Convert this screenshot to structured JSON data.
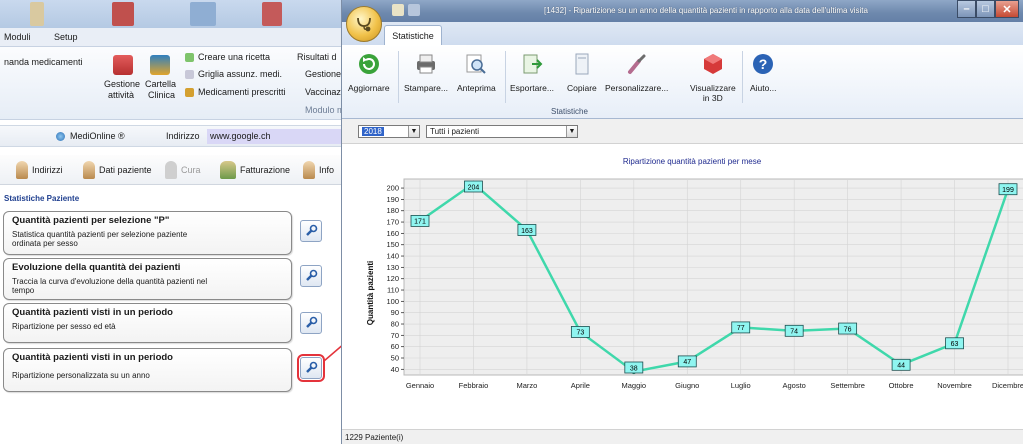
{
  "bg_app": {
    "menu": [
      "Moduli",
      "Setup"
    ],
    "ribbon": {
      "left_cut_label": "nanda medicamenti",
      "gestione_attivita": [
        "Gestione",
        "attività"
      ],
      "cartella_clinica": [
        "Cartella",
        "Clinica"
      ],
      "links": [
        "Creare una ricetta",
        "Griglia assunz. medi.",
        "Medicamenti prescritti"
      ],
      "cut_links": [
        "Risultati d",
        "Gestione",
        "Vaccinazi"
      ],
      "group_label": "Modulo m"
    },
    "address_bar": {
      "app_name": "MediOnline ®",
      "address_label": "Indirizzo",
      "url": "www.google.ch"
    },
    "tabs": [
      "Indirizzi",
      "Dati paziente",
      "Cura",
      "Fatturazione",
      "Info"
    ],
    "section_title": "Statistiche Paziente",
    "cards": [
      {
        "title": "Quantità pazienti per selezione \"P\"",
        "desc": "Statistica quantità pazienti per selezione paziente ordinata per sesso"
      },
      {
        "title": "Evoluzione della quantità dei pazienti",
        "desc": "Traccia la curva d'evoluzione della quantità pazienti nel tempo"
      },
      {
        "title": "Quantità pazienti visti in un periodo",
        "desc": "Ripartizione per sesso ed età"
      },
      {
        "title": "Quantità pazienti visti in un periodo",
        "desc": "Ripartizione personalizzata su un anno"
      }
    ]
  },
  "window": {
    "title": "[1432] - Ripartizione su un anno della quantità pazienti in rapporto alla data dell'ultima visita",
    "ribbon_tab": "Statistiche",
    "buttons": {
      "aggiornare": "Aggiornare",
      "stampare": "Stampare...",
      "anteprima": "Anteprima",
      "esportare": "Esportare...",
      "copiare": "Copiare",
      "personalizzare": "Personalizzare...",
      "visualizzare": [
        "Visualizzare",
        "in 3D"
      ],
      "aiuto": "Aiuto..."
    },
    "group_label": "Statistiche",
    "filters": {
      "year": "2018",
      "patients": "Tutti i pazienti"
    },
    "status": "1229 Paziente(i)"
  },
  "colors": {
    "line": "#3fd8ab",
    "label_fill": "#8ff5f0",
    "plot_bg": "#eeeeee",
    "callout": "#e4333b"
  },
  "chart_data": {
    "type": "line",
    "title": "Ripartizione quantità pazienti per mese",
    "ylabel": "Quantità pazienti",
    "xlabel": "",
    "categories": [
      "Gennaio",
      "Febbraio",
      "Marzo",
      "Aprile",
      "Maggio",
      "Giugno",
      "Luglio",
      "Agosto",
      "Settembre",
      "Ottobre",
      "Novembre",
      "Dicembre"
    ],
    "values": [
      171,
      204,
      163,
      73,
      38,
      47,
      77,
      74,
      76,
      44,
      63,
      199
    ],
    "yticks": [
      40,
      50,
      60,
      70,
      80,
      90,
      100,
      110,
      120,
      130,
      140,
      150,
      160,
      170,
      180,
      190,
      200
    ],
    "ylim": [
      35,
      208
    ],
    "grid": true,
    "legend": "none"
  }
}
